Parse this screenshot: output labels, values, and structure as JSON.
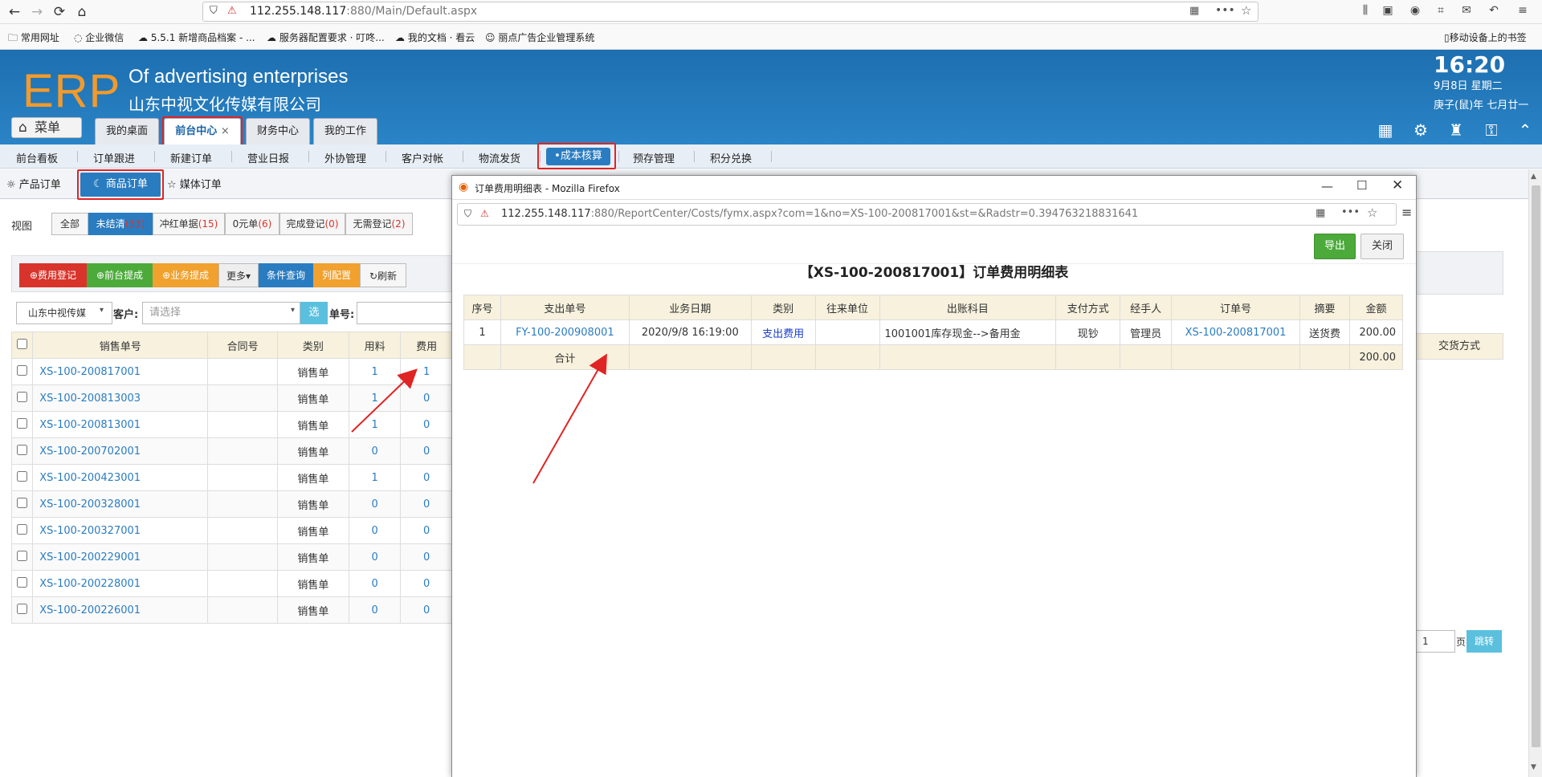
{
  "browser": {
    "url_host": "112.255.148.117",
    "url_rest": ":880/Main/Default.aspx",
    "bookmarks": [
      "常用网址",
      "企业微信",
      "5.5.1 新增商品档案 - ...",
      "服务器配置要求 · 叮咚...",
      "我的文档 · 看云",
      "丽点广告企业管理系统"
    ],
    "mobile_bookmarks": "移动设备上的书签"
  },
  "header": {
    "logo": "ERP",
    "subtitle_en": "Of advertising enterprises",
    "subtitle_cn": "山东中视文化传媒有限公司",
    "time": "16:20",
    "date": "9月8日 星期二",
    "lunar": "庚子(鼠)年 七月廿一",
    "menu_label": "菜单",
    "tabs": [
      "我的桌面",
      "前台中心",
      "财务中心",
      "我的工作"
    ],
    "close_glyph": "×"
  },
  "module_nav": [
    "前台看板",
    "订单跟进",
    "新建订单",
    "营业日报",
    "外协管理",
    "客户对帐",
    "物流发货",
    "•成本核算",
    "预存管理",
    "积分兑换"
  ],
  "subtabs": [
    "产品订单",
    "商品订单",
    "媒体订单"
  ],
  "filters": {
    "view_label": "视图",
    "all": "全部",
    "unsettled": "未结清",
    "unsettled_count": "(33)",
    "red": "冲红单据",
    "red_count": "(15)",
    "zero": "0元单",
    "zero_count": "(6)",
    "done": "完成登记",
    "done_count": "(0)",
    "noneed": "无需登记",
    "noneed_count": "(2)"
  },
  "toolbar": [
    "费用登记",
    "前台提成",
    "业务提成",
    "更多▾",
    "条件查询",
    "列配置",
    "刷新"
  ],
  "search": {
    "company": "山东中视传媒",
    "customer_label": "客户:",
    "customer_placeholder": "请选择",
    "select_btn": "选",
    "order_label": "单号:"
  },
  "left_table": {
    "headers": [
      "销售单号",
      "合同号",
      "类别",
      "用料",
      "费用"
    ],
    "rows": [
      [
        "XS-100-200817001",
        "",
        "销售单",
        "1",
        "1"
      ],
      [
        "XS-100-200813003",
        "",
        "销售单",
        "1",
        "0"
      ],
      [
        "XS-100-200813001",
        "",
        "销售单",
        "1",
        "0"
      ],
      [
        "XS-100-200702001",
        "",
        "销售单",
        "0",
        "0"
      ],
      [
        "XS-100-200423001",
        "",
        "销售单",
        "1",
        "0"
      ],
      [
        "XS-100-200328001",
        "",
        "销售单",
        "0",
        "0"
      ],
      [
        "XS-100-200327001",
        "",
        "销售单",
        "0",
        "0"
      ],
      [
        "XS-100-200229001",
        "",
        "销售单",
        "0",
        "0"
      ],
      [
        "XS-100-200228001",
        "",
        "销售单",
        "0",
        "0"
      ],
      [
        "XS-100-200226001",
        "",
        "销售单",
        "0",
        "0"
      ]
    ]
  },
  "right_column": "交货方式",
  "pager": {
    "page": "1",
    "page_label": "页",
    "jump": "跳转"
  },
  "popup": {
    "title": "订单费用明细表 - Mozilla Firefox",
    "url_host": "112.255.148.117",
    "url_rest": ":880/ReportCenter/Costs/fymx.aspx?com=1&no=XS-100-200817001&st=&Radstr=0.394763218831641",
    "export": "导出",
    "close": "关闭",
    "heading": "【XS-100-200817001】订单费用明细表",
    "headers": [
      "序号",
      "支出单号",
      "业务日期",
      "类别",
      "往来单位",
      "出账科目",
      "支付方式",
      "经手人",
      "订单号",
      "摘要",
      "金额"
    ],
    "row": [
      "1",
      "FY-100-200908001",
      "2020/9/8 16:19:00",
      "支出费用",
      "",
      "1001001库存现金-->备用金",
      "现钞",
      "管理员",
      "XS-100-200817001",
      "送货费",
      "200.00"
    ],
    "sum_label": "合计",
    "sum_value": "200.00"
  },
  "colors": {
    "brand_blue": "#2a7cc1",
    "logo_orange": "#f39a2c",
    "highlight_red": "#e02424"
  }
}
